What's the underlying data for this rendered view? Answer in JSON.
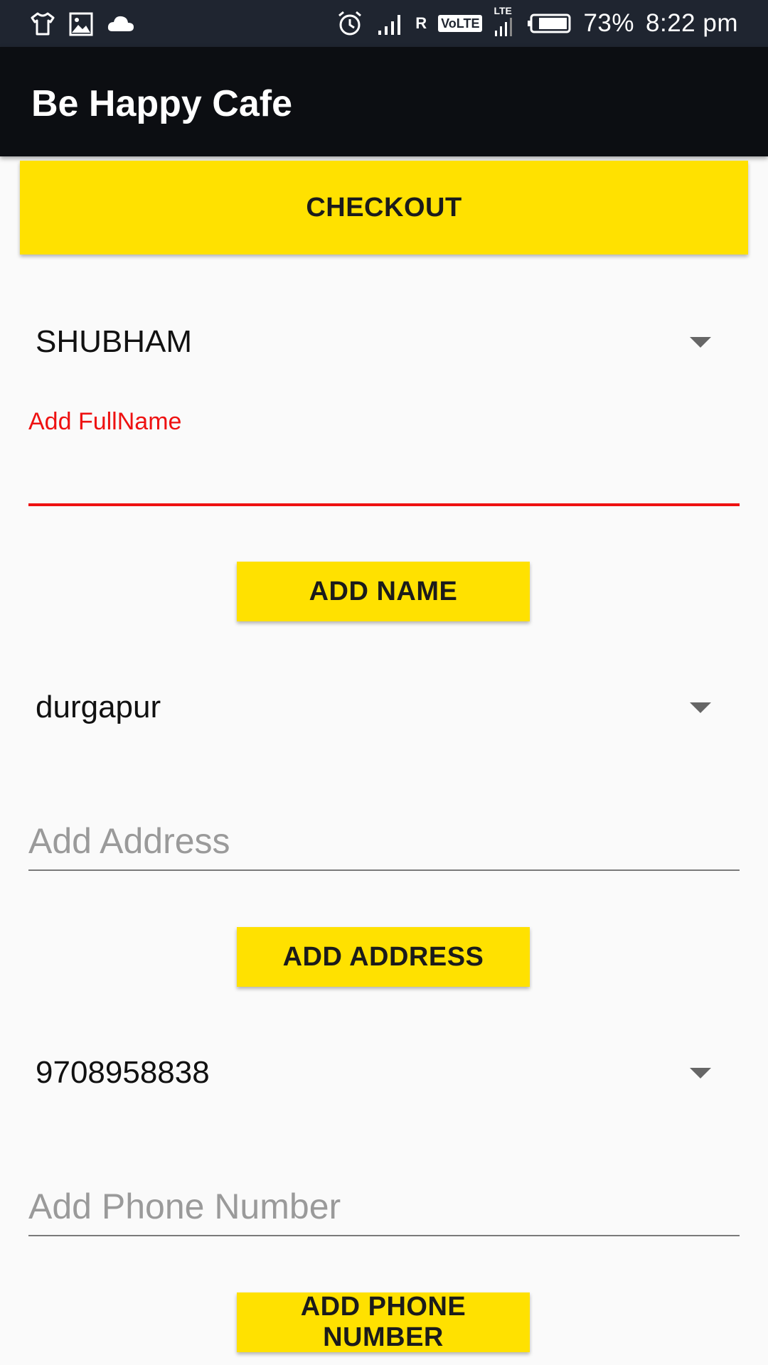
{
  "status_bar": {
    "left_icons": [
      "shirt-icon",
      "image-icon",
      "cloud-icon"
    ],
    "right_icons": [
      "alarm-icon",
      "signal-icon",
      "roaming-indicator",
      "volte-badge",
      "lte-signal-icon",
      "battery-icon"
    ],
    "roaming": "R",
    "volte": "VoLTE",
    "lte": "LTE",
    "battery": "73%",
    "time": "8:22 pm"
  },
  "app_bar": {
    "title": "Be Happy Cafe"
  },
  "checkout_button": "CHECKOUT",
  "name_section": {
    "spinner_value": "SHUBHAM",
    "field_label": "Add FullName",
    "field_value": "",
    "button": "ADD NAME"
  },
  "address_section": {
    "spinner_value": "durgapur",
    "field_placeholder": "Add Address",
    "button": "ADD ADDRESS"
  },
  "phone_section": {
    "spinner_value": "9708958838",
    "field_placeholder": "Add Phone Number",
    "button": "ADD PHONE NUMBER"
  },
  "colors": {
    "accent": "#ffe100",
    "error": "#ee1111",
    "app_bar": "#0c0e12",
    "status_bar": "#1f2530"
  }
}
